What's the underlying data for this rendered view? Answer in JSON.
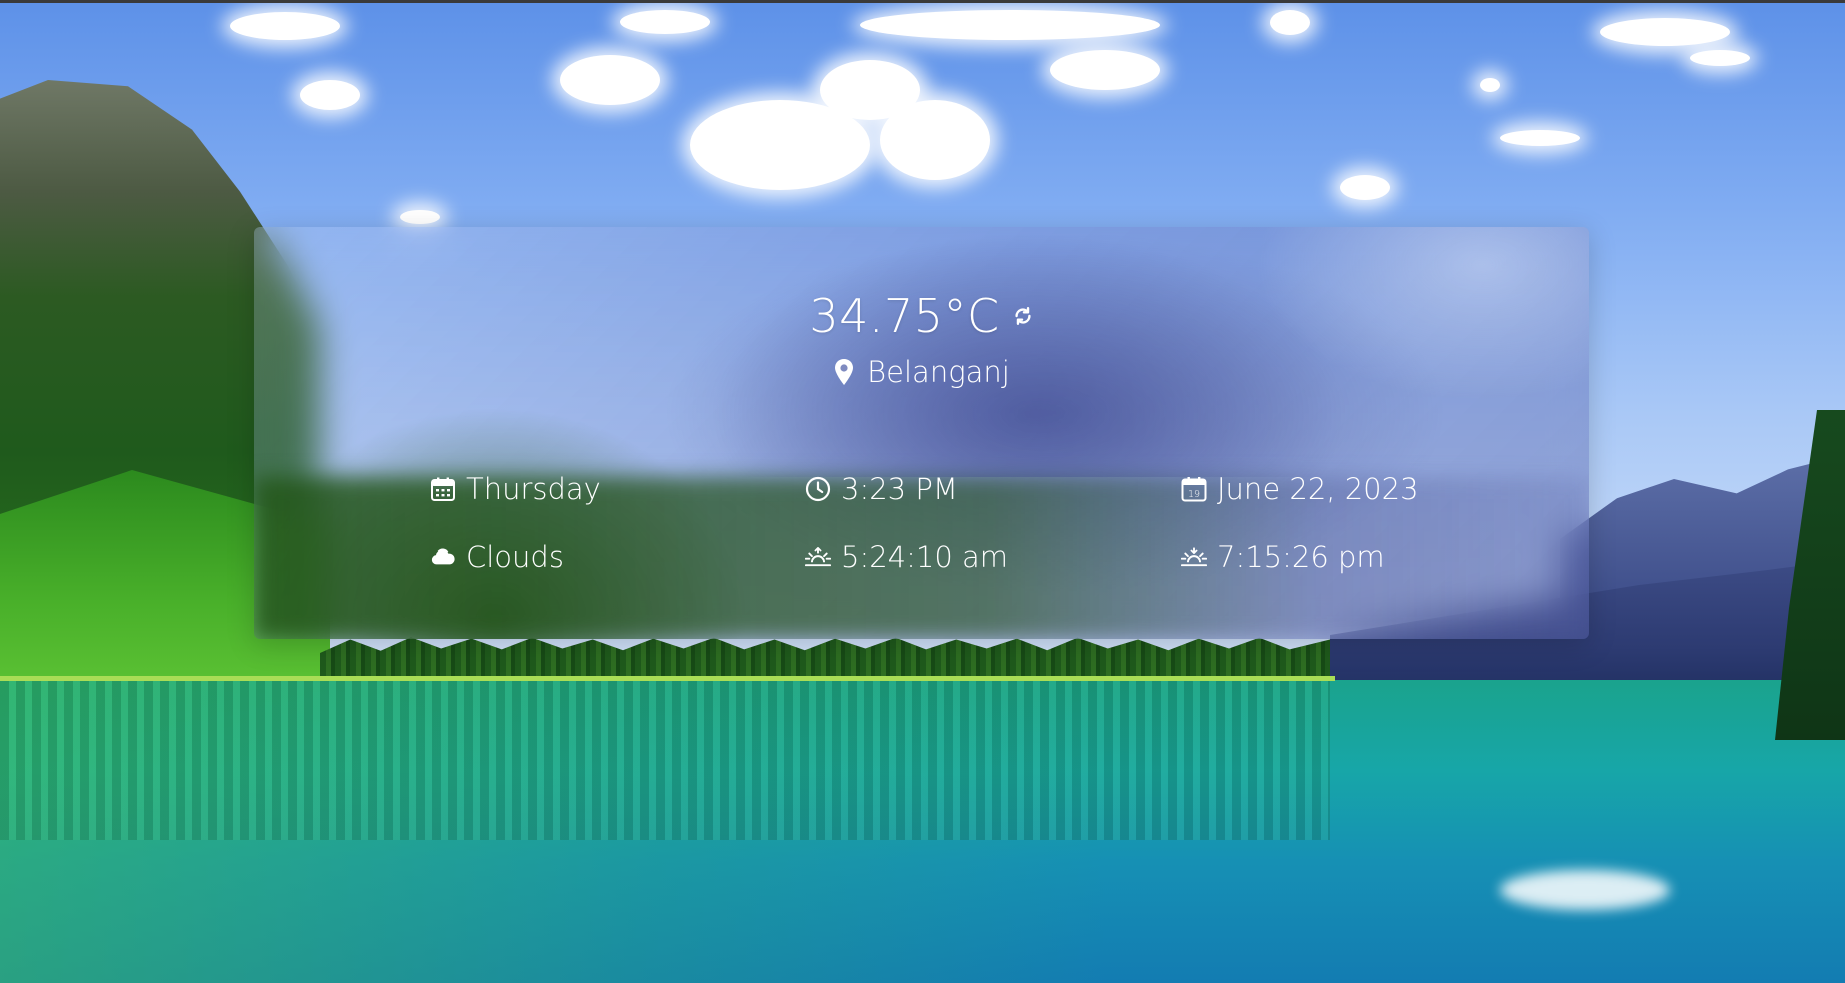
{
  "weather": {
    "temperature": "34.75°C",
    "location": "Belanganj"
  },
  "details": {
    "day": "Thursday",
    "time": "3:23 PM",
    "date": "June 22, 2023",
    "condition": "Clouds",
    "sunrise": "5:24:10 am",
    "sunset": "7:15:26 pm"
  },
  "icons": {
    "refresh": "refresh-icon",
    "location": "location-pin-icon",
    "day": "calendar-icon",
    "time": "clock-icon",
    "date": "calendar-date-icon",
    "condition": "cloud-icon",
    "sunrise": "sunrise-icon",
    "sunset": "sunset-icon",
    "date_badge": "19"
  },
  "colors": {
    "text": "#ffffff"
  }
}
